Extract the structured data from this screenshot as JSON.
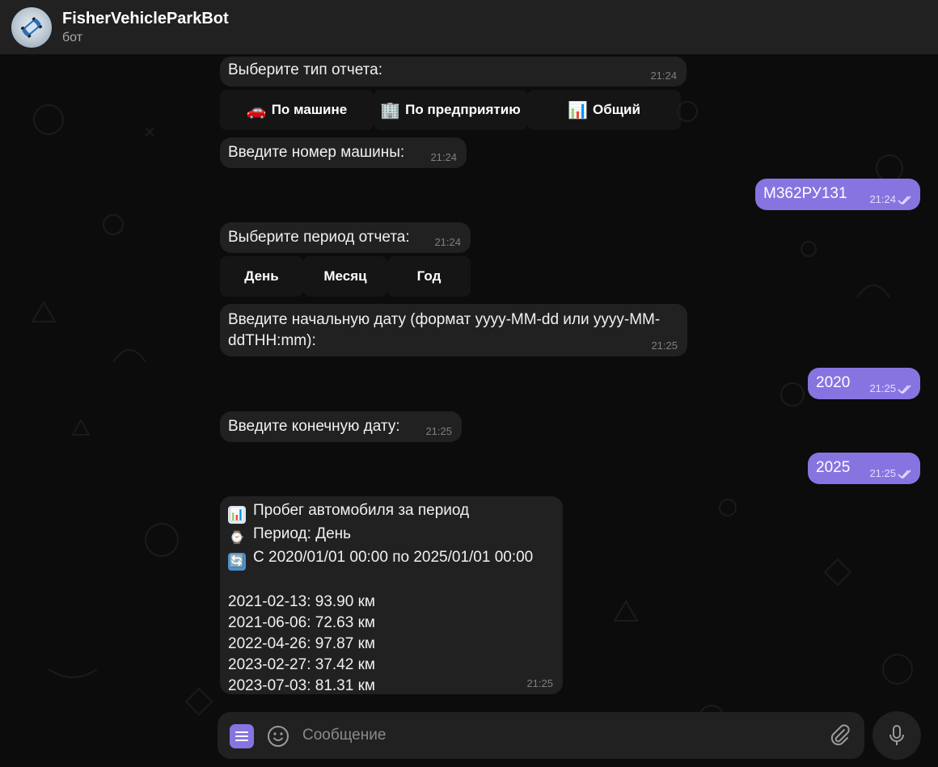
{
  "header": {
    "title": "FisherVehicleParkBot",
    "status": "бот"
  },
  "messages": {
    "m1": {
      "text": "Выберите тип отчета:",
      "time": "21:24"
    },
    "kb1": [
      {
        "emoji": "🚗",
        "label": "По машине"
      },
      {
        "emoji": "🏢",
        "label": "По предприятию"
      },
      {
        "emoji": "📊",
        "label": "Общий"
      }
    ],
    "m2": {
      "text": "Введите номер машины:",
      "time": "21:24"
    },
    "m3": {
      "text": "М362РУ131",
      "time": "21:24"
    },
    "m4": {
      "text": "Выберите период отчета:",
      "time": "21:24"
    },
    "kb2": [
      {
        "label": "День"
      },
      {
        "label": "Месяц"
      },
      {
        "label": "Год"
      }
    ],
    "m5": {
      "line1": "Введите начальную дату (формат yyyy-MM-dd или yyyy-MM-",
      "line2": "ddTHH:mm):",
      "time": "21:25"
    },
    "m6": {
      "text": "2020",
      "time": "21:25"
    },
    "m7": {
      "text": "Введите конечную дату:",
      "time": "21:25"
    },
    "m8": {
      "text": "2025",
      "time": "21:25"
    },
    "report": {
      "title_emoji": "📊",
      "title": "Пробег автомобиля за период",
      "period_emoji": "⌚",
      "period": "Период: День",
      "range_emoji": "🔄",
      "range": "С 2020/01/01 00:00 по 2025/01/01 00:00",
      "entries": [
        "2021-02-13: 93.90 км",
        "2021-06-06: 72.63 км",
        "2022-04-26: 97.87 км",
        "2023-02-27: 37.42 км",
        "2023-07-03: 81.31 км"
      ],
      "time": "21:25"
    }
  },
  "composer": {
    "placeholder": "Сообщение"
  },
  "colors": {
    "accent": "#8774e1",
    "bubble_in": "#212121",
    "header": "#212121"
  },
  "icons": {
    "menu": "menu-icon",
    "emoji": "smile-icon",
    "attach": "paperclip-icon",
    "mic": "microphone-icon",
    "read": "double-check-icon"
  }
}
